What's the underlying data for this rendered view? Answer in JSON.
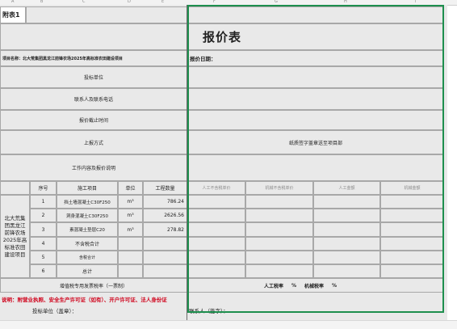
{
  "sheet": {
    "tag": "附表1",
    "title": "报价表",
    "project_name": "项目名称：北大荒集团黑龙江前锋农场2025年高标准农田建设项目",
    "quote_date_label": "报价日期：",
    "field_labels": [
      "投标单位",
      "联系人及联系电话",
      "报价截止时间",
      "上报方式",
      "工作内容及报价说明"
    ],
    "submit_method_value": "纸质签字盖章送至项目部"
  },
  "table": {
    "headers": [
      "序号",
      "施工项目",
      "单位",
      "工程数量",
      "人工不含税单价",
      "机械不含税单价",
      "人工金额",
      "机械金额"
    ],
    "row_group_label": "北大荒集团黑龙江前锋农场2025年高标准农田建设项目",
    "rows": [
      {
        "no": "1",
        "item": "挡土墙混凝土C30F250",
        "unit": "m³",
        "qty": "786.24"
      },
      {
        "no": "2",
        "item": "洞身混凝土C30F250",
        "unit": "m³",
        "qty": "2626.56"
      },
      {
        "no": "3",
        "item": "素混凝土垫层C20",
        "unit": "m³",
        "qty": "278.82"
      },
      {
        "no": "4",
        "item": "不含税合计",
        "unit": "",
        "qty": ""
      },
      {
        "no": "5",
        "item": "含税合计",
        "unit": "",
        "qty": ""
      },
      {
        "no": "6",
        "item": "总计",
        "unit": "",
        "qty": ""
      }
    ]
  },
  "footer": {
    "vat_type": "增值税专用发票税率（一票制）",
    "labor_tax": "人工税率",
    "percent1": "%",
    "machine_tax": "机械税率",
    "percent2": "%",
    "note": "说明：附营业执照、安全生产许可证（如有）、开户许可证、法人身份证",
    "bidder_sign": "投标单位（盖章）：",
    "contact_sign": "联系人（签字）："
  },
  "column_letters": [
    "A",
    "B",
    "C",
    "D",
    "E",
    "F",
    "G",
    "H",
    "I"
  ],
  "colors": {
    "selection": "#1e8f4e",
    "note": "#d0021b",
    "cell_bg": "#e9e9e9"
  }
}
